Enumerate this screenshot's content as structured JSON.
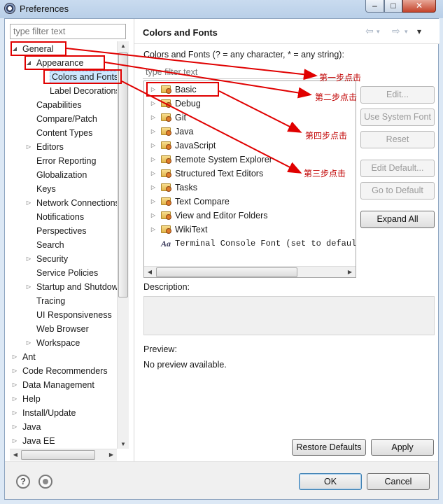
{
  "window": {
    "title": "Preferences",
    "minimize": "–",
    "maximize": "□",
    "close": "✕"
  },
  "left": {
    "filter_placeholder": "type filter text",
    "tree": [
      {
        "label": "General",
        "level": 0,
        "state": "expanded"
      },
      {
        "label": "Appearance",
        "level": 1,
        "state": "expanded"
      },
      {
        "label": "Colors and Fonts",
        "level": 2,
        "state": "leaf",
        "selected": true
      },
      {
        "label": "Label Decorations",
        "level": 2,
        "state": "leaf"
      },
      {
        "label": "Capabilities",
        "level": 1,
        "state": "leaf"
      },
      {
        "label": "Compare/Patch",
        "level": 1,
        "state": "leaf"
      },
      {
        "label": "Content Types",
        "level": 1,
        "state": "leaf"
      },
      {
        "label": "Editors",
        "level": 1,
        "state": "collapsed"
      },
      {
        "label": "Error Reporting",
        "level": 1,
        "state": "leaf"
      },
      {
        "label": "Globalization",
        "level": 1,
        "state": "leaf"
      },
      {
        "label": "Keys",
        "level": 1,
        "state": "leaf"
      },
      {
        "label": "Network Connections",
        "level": 1,
        "state": "collapsed"
      },
      {
        "label": "Notifications",
        "level": 1,
        "state": "leaf"
      },
      {
        "label": "Perspectives",
        "level": 1,
        "state": "leaf"
      },
      {
        "label": "Search",
        "level": 1,
        "state": "leaf"
      },
      {
        "label": "Security",
        "level": 1,
        "state": "collapsed"
      },
      {
        "label": "Service Policies",
        "level": 1,
        "state": "leaf"
      },
      {
        "label": "Startup and Shutdown",
        "level": 1,
        "state": "collapsed"
      },
      {
        "label": "Tracing",
        "level": 1,
        "state": "leaf"
      },
      {
        "label": "UI Responsiveness",
        "level": 1,
        "state": "leaf"
      },
      {
        "label": "Web Browser",
        "level": 1,
        "state": "leaf"
      },
      {
        "label": "Workspace",
        "level": 1,
        "state": "collapsed"
      },
      {
        "label": "Ant",
        "level": 0,
        "state": "collapsed"
      },
      {
        "label": "Code Recommenders",
        "level": 0,
        "state": "collapsed"
      },
      {
        "label": "Data Management",
        "level": 0,
        "state": "collapsed"
      },
      {
        "label": "Help",
        "level": 0,
        "state": "collapsed"
      },
      {
        "label": "Install/Update",
        "level": 0,
        "state": "collapsed"
      },
      {
        "label": "Java",
        "level": 0,
        "state": "collapsed"
      },
      {
        "label": "Java EE",
        "level": 0,
        "state": "collapsed"
      }
    ]
  },
  "page": {
    "title": "Colors and Fonts",
    "nav": {
      "back": "⇦",
      "forward": "⇨",
      "menu": "▾"
    },
    "description_label": "Colors and Fonts (? = any character, * = any string):",
    "filter_placeholder": "type filter text",
    "font_tree": [
      {
        "label": "Basic",
        "kind": "folder"
      },
      {
        "label": "Debug",
        "kind": "folder"
      },
      {
        "label": "Git",
        "kind": "folder"
      },
      {
        "label": "Java",
        "kind": "folder"
      },
      {
        "label": "JavaScript",
        "kind": "folder"
      },
      {
        "label": "Remote System Explorer",
        "kind": "folder"
      },
      {
        "label": "Structured Text Editors",
        "kind": "folder"
      },
      {
        "label": "Tasks",
        "kind": "folder"
      },
      {
        "label": "Text Compare",
        "kind": "folder"
      },
      {
        "label": "View and Editor Folders",
        "kind": "folder"
      },
      {
        "label": "WikiText",
        "kind": "folder"
      },
      {
        "label": "Terminal Console Font (set to default",
        "kind": "font",
        "icon_text": "Aa"
      }
    ],
    "buttons": {
      "edit": "Edit...",
      "use_system_font": "Use System Font",
      "reset": "Reset",
      "edit_default": "Edit Default...",
      "go_to_default": "Go to Default",
      "expand_all": "Expand All"
    },
    "description": "Description:",
    "preview": "Preview:",
    "preview_text": "No preview available.",
    "restore_defaults": "Restore Defaults",
    "apply": "Apply"
  },
  "footer": {
    "help_icon_text": "?",
    "ok": "OK",
    "cancel": "Cancel"
  },
  "annotations": {
    "step1": "第一步点击",
    "step2": "第二步点击",
    "step3": "第三步点击",
    "step4": "第四步点击"
  },
  "colors": {
    "annotation_red": "#e00000",
    "selection": "#cde8ff",
    "folder": "#e2b54a"
  }
}
